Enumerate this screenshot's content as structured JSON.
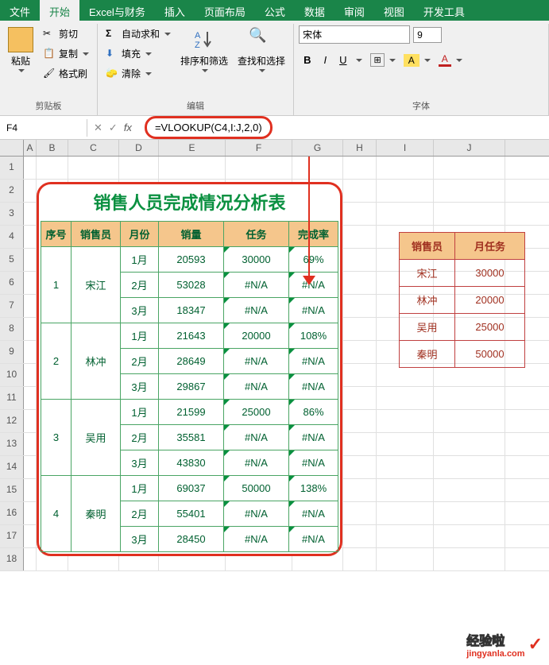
{
  "tabs": [
    "文件",
    "开始",
    "Excel与财务",
    "插入",
    "页面布局",
    "公式",
    "数据",
    "审阅",
    "视图",
    "开发工具"
  ],
  "active_tab": 1,
  "ribbon": {
    "clipboard": {
      "label": "剪贴板",
      "paste": "粘贴",
      "cut": "剪切",
      "copy": "复制",
      "brush": "格式刷"
    },
    "editing": {
      "label": "编辑",
      "autosum": "自动求和",
      "fill": "填充",
      "clear": "清除",
      "sort": "排序和筛选",
      "find": "查找和选择"
    },
    "font": {
      "label": "字体",
      "family": "宋体",
      "size": "9",
      "bold": "B",
      "italic": "I",
      "underline": "U"
    }
  },
  "name_box": "F4",
  "fx": {
    "cancel": "✕",
    "confirm": "✓",
    "fx": "fx"
  },
  "formula": "=VLOOKUP(C4,I:J,2,0)",
  "columns": [
    "A",
    "B",
    "C",
    "D",
    "E",
    "F",
    "G",
    "H",
    "I",
    "J"
  ],
  "rows": [
    1,
    2,
    3,
    4,
    5,
    6,
    7,
    8,
    9,
    10,
    11,
    12,
    13,
    14,
    15,
    16,
    17,
    18
  ],
  "main_table": {
    "title": "销售人员完成情况分析表",
    "headers": [
      "序号",
      "销售员",
      "月份",
      "销量",
      "任务",
      "完成率"
    ],
    "groups": [
      {
        "num": "1",
        "name": "宋江",
        "rows": [
          {
            "month": "1月",
            "vol": "20593",
            "task": "30000",
            "rate": "69%"
          },
          {
            "month": "2月",
            "vol": "53028",
            "task": "#N/A",
            "rate": "#N/A"
          },
          {
            "month": "3月",
            "vol": "18347",
            "task": "#N/A",
            "rate": "#N/A"
          }
        ]
      },
      {
        "num": "2",
        "name": "林冲",
        "rows": [
          {
            "month": "1月",
            "vol": "21643",
            "task": "20000",
            "rate": "108%"
          },
          {
            "month": "2月",
            "vol": "28649",
            "task": "#N/A",
            "rate": "#N/A"
          },
          {
            "month": "3月",
            "vol": "29867",
            "task": "#N/A",
            "rate": "#N/A"
          }
        ]
      },
      {
        "num": "3",
        "name": "吴用",
        "rows": [
          {
            "month": "1月",
            "vol": "21599",
            "task": "25000",
            "rate": "86%"
          },
          {
            "month": "2月",
            "vol": "35581",
            "task": "#N/A",
            "rate": "#N/A"
          },
          {
            "month": "3月",
            "vol": "43830",
            "task": "#N/A",
            "rate": "#N/A"
          }
        ]
      },
      {
        "num": "4",
        "name": "秦明",
        "rows": [
          {
            "month": "1月",
            "vol": "69037",
            "task": "50000",
            "rate": "138%"
          },
          {
            "month": "2月",
            "vol": "55401",
            "task": "#N/A",
            "rate": "#N/A"
          },
          {
            "month": "3月",
            "vol": "28450",
            "task": "#N/A",
            "rate": "#N/A"
          }
        ]
      }
    ]
  },
  "lookup_table": {
    "headers": [
      "销售员",
      "月任务"
    ],
    "rows": [
      {
        "name": "宋江",
        "task": "30000"
      },
      {
        "name": "林冲",
        "task": "20000"
      },
      {
        "name": "吴用",
        "task": "25000"
      },
      {
        "name": "秦明",
        "task": "50000"
      }
    ]
  },
  "watermark": {
    "text": "经验啦",
    "sub": "jingyanla.com",
    "check": "✓"
  }
}
